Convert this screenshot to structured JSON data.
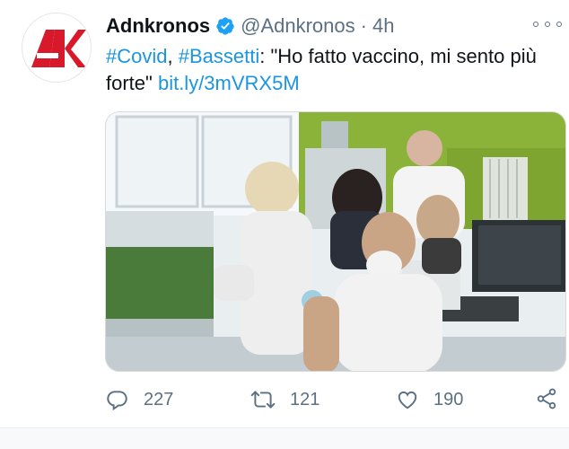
{
  "tweet": {
    "display_name": "Adnkronos",
    "handle": "@Adnkronos",
    "separator": "·",
    "timestamp": "4h",
    "verified_icon": "verified-badge-icon",
    "avatar_icon": "adnkronos-logo",
    "text": {
      "hashtag1": "#Covid",
      "comma": ", ",
      "hashtag2": "#Bassetti",
      "body": ": \"Ho fatto vaccino, mi sento più forte\" ",
      "link": "bit.ly/3mVRX5M"
    },
    "colors": {
      "link": "#1b95e0",
      "verified": "#1da1f2",
      "brand_red": "#d7192b",
      "secondary_text": "#5b7083"
    }
  },
  "actions": {
    "replies": "227",
    "retweets": "121",
    "likes": "190",
    "reply_icon": "reply-icon",
    "retweet_icon": "retweet-icon",
    "like_icon": "heart-icon",
    "share_icon": "share-icon",
    "more_icon": "more-options-icon"
  }
}
